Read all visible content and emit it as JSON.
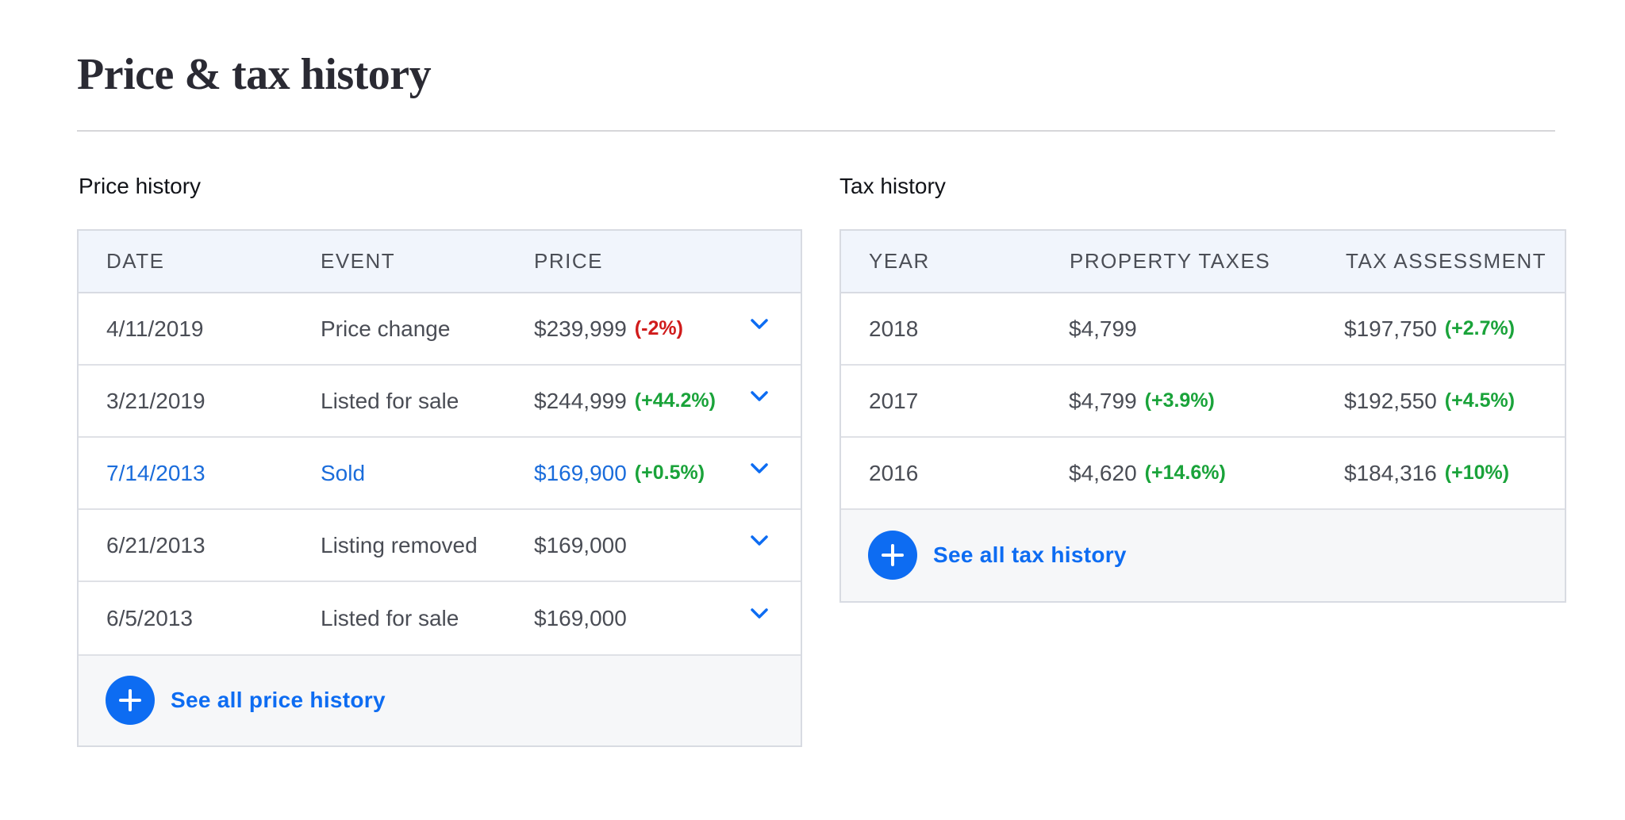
{
  "page_title": "Price & tax history",
  "colors": {
    "accent": "#0d6cf2",
    "negative": "#d01b1b",
    "positive": "#1aa33a",
    "header_bg": "#f1f5fc",
    "footer_bg": "#f6f7f9"
  },
  "price_history": {
    "title": "Price history",
    "columns": [
      "DATE",
      "EVENT",
      "PRICE"
    ],
    "rows": [
      {
        "date": "4/11/2019",
        "event": "Price change",
        "price": "$239,999",
        "change": "(-2%)",
        "change_type": "negative",
        "highlighted": false,
        "icon": "chevron-down-icon"
      },
      {
        "date": "3/21/2019",
        "event": "Listed for sale",
        "price": "$244,999",
        "change": "(+44.2%)",
        "change_type": "positive",
        "highlighted": false,
        "icon": "chevron-down-icon"
      },
      {
        "date": "7/14/2013",
        "event": "Sold",
        "price": "$169,900",
        "change": "(+0.5%)",
        "change_type": "positive",
        "highlighted": true,
        "icon": "chevron-down-icon"
      },
      {
        "date": "6/21/2013",
        "event": "Listing removed",
        "price": "$169,000",
        "change": "",
        "change_type": "none",
        "highlighted": false,
        "icon": "chevron-down-icon"
      },
      {
        "date": "6/5/2013",
        "event": "Listed for sale",
        "price": "$169,000",
        "change": "",
        "change_type": "none",
        "highlighted": false,
        "icon": "chevron-down-icon"
      }
    ],
    "see_all_label": "See all price history",
    "see_all_icon": "plus-circle-icon"
  },
  "tax_history": {
    "title": "Tax history",
    "columns": [
      "YEAR",
      "PROPERTY TAXES",
      "TAX ASSESSMENT"
    ],
    "rows": [
      {
        "year": "2018",
        "taxes": "$4,799",
        "taxes_change": "",
        "assessment": "$197,750",
        "assessment_change": "(+2.7%)"
      },
      {
        "year": "2017",
        "taxes": "$4,799",
        "taxes_change": "(+3.9%)",
        "assessment": "$192,550",
        "assessment_change": "(+4.5%)"
      },
      {
        "year": "2016",
        "taxes": "$4,620",
        "taxes_change": "(+14.6%)",
        "assessment": "$184,316",
        "assessment_change": "(+10%)"
      }
    ],
    "see_all_label": "See all tax history",
    "see_all_icon": "plus-circle-icon"
  }
}
